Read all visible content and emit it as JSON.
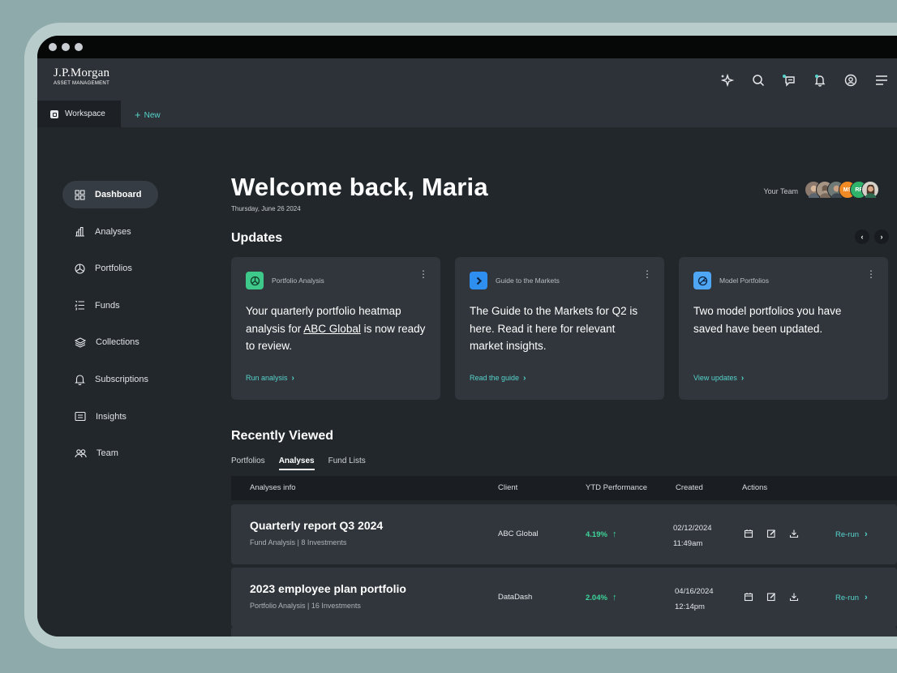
{
  "brand": {
    "line1": "J.P.Morgan",
    "line2": "ASSET MANAGEMENT"
  },
  "nav_icons": [
    "sparkle-icon",
    "search-icon",
    "chat-icon",
    "notification-icon",
    "account-icon",
    "menu-icon"
  ],
  "tabs": {
    "workspace": "Workspace",
    "new": "New"
  },
  "sidebar": {
    "items": [
      {
        "label": "Dashboard",
        "icon": "dashboard-icon",
        "active": true
      },
      {
        "label": "Analyses",
        "icon": "analyses-icon"
      },
      {
        "label": "Portfolios",
        "icon": "portfolios-icon"
      },
      {
        "label": "Funds",
        "icon": "funds-icon"
      },
      {
        "label": "Collections",
        "icon": "collections-icon"
      },
      {
        "label": "Subscriptions",
        "icon": "bell-icon"
      },
      {
        "label": "Insights",
        "icon": "insights-icon"
      },
      {
        "label": "Team",
        "icon": "team-icon"
      }
    ]
  },
  "header": {
    "welcome": "Welcome back, Maria",
    "date": "Thursday, June 26 2024",
    "team_label": "Your Team",
    "team_avatars": [
      "",
      "",
      "",
      "MS",
      "RF",
      ""
    ]
  },
  "updates": {
    "title": "Updates",
    "cards": [
      {
        "tag": "Portfolio Analysis",
        "text_before": "Your quarterly portfolio heatmap analysis for ",
        "link_text": "ABC Global",
        "text_after": " is now ready to review.",
        "action": "Run analysis",
        "color": "#3ec98a"
      },
      {
        "tag": "Guide to the Markets",
        "text": "The Guide to the Markets for Q2 is here. Read it here for relevant market insights.",
        "action": "Read the guide",
        "color": "#2f8ff0"
      },
      {
        "tag": "Model Portfolios",
        "text": "Two model portfolios you have saved have been updated.",
        "action": "View updates",
        "color": "#4fa6f5"
      }
    ]
  },
  "recent": {
    "title": "Recently Viewed",
    "tabs": [
      "Portfolios",
      "Analyses",
      "Fund Lists"
    ],
    "active_tab": "Analyses",
    "columns": [
      "Analyses info",
      "Client",
      "YTD Performance",
      "Created",
      "Actions"
    ],
    "rows": [
      {
        "title": "Quarterly report Q3 2024",
        "subtitle": "Fund Analysis | 8 Investments",
        "client": "ABC Global",
        "ytd": "4.19%",
        "date": "02/12/2024",
        "time": "11:49am",
        "action": "Re-run"
      },
      {
        "title": "2023 employee plan portfolio",
        "subtitle": "Portfolio Analysis | 16 Investments",
        "client": "DataDash",
        "ytd": "2.04%",
        "date": "04/16/2024",
        "time": "12:14pm",
        "action": "Re-run"
      }
    ]
  },
  "colors": {
    "accent": "#56d4cc",
    "positive": "#3ed49a",
    "background": "#22272c",
    "card": "#30363c"
  }
}
